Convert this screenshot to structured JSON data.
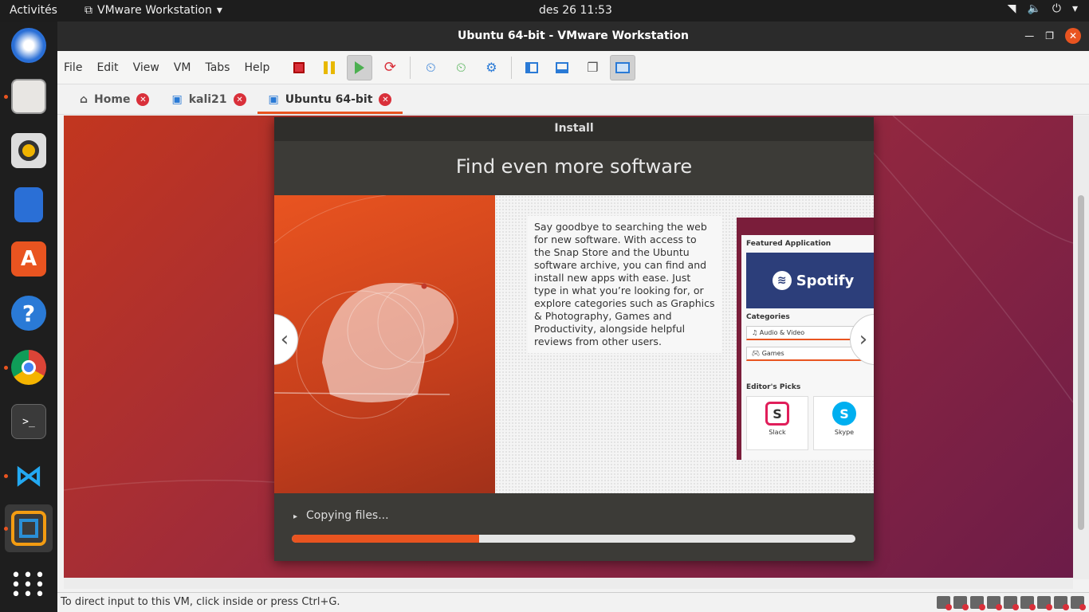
{
  "topbar": {
    "activities": "Activités",
    "app_menu": "VMware Workstation",
    "clock": "des 26  11:53"
  },
  "dock": {
    "apps": [
      "thunderbird-icon",
      "files-icon",
      "rhythmbox-icon",
      "writer-icon",
      "software-icon",
      "help-icon",
      "chrome-icon",
      "terminal-icon",
      "vscode-icon",
      "vmware-icon",
      "app-grid-icon"
    ]
  },
  "window": {
    "title": "Ubuntu 64-bit - VMware Workstation"
  },
  "menubar": {
    "items": [
      "File",
      "Edit",
      "View",
      "VM",
      "Tabs",
      "Help"
    ]
  },
  "tabs": [
    {
      "label": "Home"
    },
    {
      "label": "kali21"
    },
    {
      "label": "Ubuntu 64-bit"
    }
  ],
  "installer": {
    "window_title": "Install",
    "heading": "Find even more software",
    "slide_text": "Say goodbye to searching the web for new software. With access to the Snap Store and the Ubuntu software archive, you can find and install new apps with ease. Just type in what you’re looking for, or explore categories such as Graphics & Photography, Games and Productivity, alongside helpful reviews from other users.",
    "mock": {
      "featured_label": "Featured Application",
      "featured_app": "Spotify",
      "categories_label": "Categories",
      "categories": [
        "Audio & Video",
        "Games"
      ],
      "picks_label": "Editor's Picks",
      "picks": [
        "Slack",
        "Skype"
      ]
    },
    "progress_label": "Copying files...",
    "progress": 0.333
  },
  "status": {
    "message": "To direct input to this VM, click inside or press Ctrl+G."
  },
  "colors": {
    "accent": "#e95420",
    "close_red": "#d9303a"
  }
}
